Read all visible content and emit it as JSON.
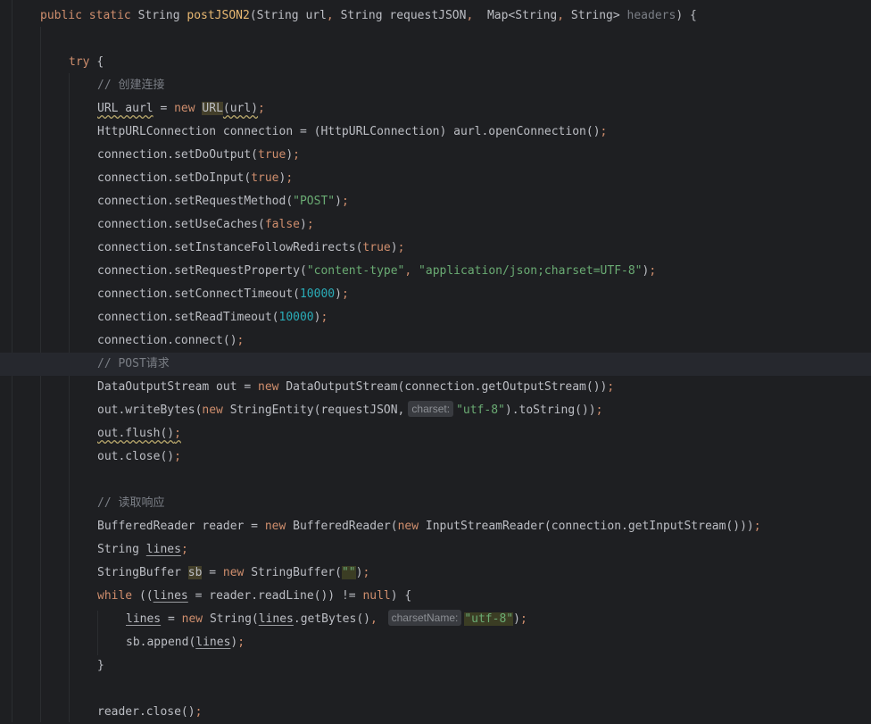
{
  "editor": {
    "lines": [
      {
        "id": "sig",
        "current": false,
        "tokens": [
          {
            "t": "public static ",
            "c": "kw"
          },
          {
            "t": "String ",
            "c": "punct"
          },
          {
            "t": "postJSON2",
            "c": "fnd"
          },
          {
            "t": "(String url",
            "c": "punct"
          },
          {
            "t": ", ",
            "c": "kw"
          },
          {
            "t": "String requestJSON",
            "c": "punct"
          },
          {
            "t": ",  ",
            "c": "kw"
          },
          {
            "t": "Map<String",
            "c": "punct"
          },
          {
            "t": ", ",
            "c": "kw"
          },
          {
            "t": "String> ",
            "c": "punct"
          },
          {
            "t": "headers",
            "c": "muted"
          },
          {
            "t": ") {",
            "c": "punct"
          }
        ]
      },
      {
        "id": "blank1",
        "tokens": []
      },
      {
        "id": "try",
        "tokens": [
          {
            "t": "try ",
            "c": "kw"
          },
          {
            "t": "{",
            "c": "punct"
          }
        ]
      },
      {
        "id": "c1",
        "tokens": [
          {
            "t": "// 创建连接",
            "c": "cmt"
          }
        ]
      },
      {
        "id": "l1",
        "tokens": [
          {
            "t": "URL aurl",
            "c": "wavy"
          },
          {
            "t": " = ",
            "c": "punct"
          },
          {
            "t": "new ",
            "c": "kw"
          },
          {
            "t": "URL",
            "c": "hl"
          },
          {
            "t": "(url)",
            "c": "wavy"
          },
          {
            "t": ";",
            "c": "kw"
          }
        ]
      },
      {
        "id": "l2",
        "tokens": [
          {
            "t": "HttpURLConnection connection = (HttpURLConnection) aurl.openConnection()",
            "c": "punct"
          },
          {
            "t": ";",
            "c": "kw"
          }
        ]
      },
      {
        "id": "l3",
        "tokens": [
          {
            "t": "connection.setDoOutput(",
            "c": "punct"
          },
          {
            "t": "true",
            "c": "kw"
          },
          {
            "t": ")",
            "c": "punct"
          },
          {
            "t": ";",
            "c": "kw"
          }
        ]
      },
      {
        "id": "l4",
        "tokens": [
          {
            "t": "connection.setDoInput(",
            "c": "punct"
          },
          {
            "t": "true",
            "c": "kw"
          },
          {
            "t": ")",
            "c": "punct"
          },
          {
            "t": ";",
            "c": "kw"
          }
        ]
      },
      {
        "id": "l5",
        "tokens": [
          {
            "t": "connection.setRequestMethod(",
            "c": "punct"
          },
          {
            "t": "\"POST\"",
            "c": "str"
          },
          {
            "t": ")",
            "c": "punct"
          },
          {
            "t": ";",
            "c": "kw"
          }
        ]
      },
      {
        "id": "l6",
        "tokens": [
          {
            "t": "connection.setUseCaches(",
            "c": "punct"
          },
          {
            "t": "false",
            "c": "kw"
          },
          {
            "t": ")",
            "c": "punct"
          },
          {
            "t": ";",
            "c": "kw"
          }
        ]
      },
      {
        "id": "l7",
        "tokens": [
          {
            "t": "connection.setInstanceFollowRedirects(",
            "c": "punct"
          },
          {
            "t": "true",
            "c": "kw"
          },
          {
            "t": ")",
            "c": "punct"
          },
          {
            "t": ";",
            "c": "kw"
          }
        ]
      },
      {
        "id": "l8",
        "tokens": [
          {
            "t": "connection.setRequestProperty(",
            "c": "punct"
          },
          {
            "t": "\"content-type\"",
            "c": "str"
          },
          {
            "t": ", ",
            "c": "kw"
          },
          {
            "t": "\"application/json;charset=UTF-8\"",
            "c": "str"
          },
          {
            "t": ")",
            "c": "punct"
          },
          {
            "t": ";",
            "c": "kw"
          }
        ]
      },
      {
        "id": "l9",
        "tokens": [
          {
            "t": "connection.setConnectTimeout(",
            "c": "punct"
          },
          {
            "t": "10000",
            "c": "num"
          },
          {
            "t": ")",
            "c": "punct"
          },
          {
            "t": ";",
            "c": "kw"
          }
        ]
      },
      {
        "id": "l10",
        "tokens": [
          {
            "t": "connection.setReadTimeout(",
            "c": "punct"
          },
          {
            "t": "10000",
            "c": "num"
          },
          {
            "t": ")",
            "c": "punct"
          },
          {
            "t": ";",
            "c": "kw"
          }
        ]
      },
      {
        "id": "l11",
        "tokens": [
          {
            "t": "connection.connect()",
            "c": "punct"
          },
          {
            "t": ";",
            "c": "kw"
          }
        ]
      },
      {
        "id": "c2",
        "current": true,
        "tokens": [
          {
            "t": "// POST请求",
            "c": "cmt"
          }
        ]
      },
      {
        "id": "l12",
        "tokens": [
          {
            "t": "DataOutputStream out = ",
            "c": "punct"
          },
          {
            "t": "new ",
            "c": "kw"
          },
          {
            "t": "DataOutputStream(connection.getOutputStream())",
            "c": "punct"
          },
          {
            "t": ";",
            "c": "kw"
          }
        ]
      },
      {
        "id": "l13",
        "tokens": [
          {
            "t": "out.writeBytes(",
            "c": "punct"
          },
          {
            "t": "new ",
            "c": "kw"
          },
          {
            "t": "StringEntity(requestJSON,",
            "c": "punct"
          },
          {
            "t": "charset:",
            "c": "hint"
          },
          {
            "t": "\"utf-8\"",
            "c": "str"
          },
          {
            "t": ").toString())",
            "c": "punct"
          },
          {
            "t": ";",
            "c": "kw"
          }
        ]
      },
      {
        "id": "l14",
        "tokens": [
          {
            "t": "out.flush()",
            "c": "wavy"
          },
          {
            "t": ";",
            "c": "kw wavy"
          }
        ]
      },
      {
        "id": "l15",
        "tokens": [
          {
            "t": "out.close()",
            "c": "punct"
          },
          {
            "t": ";",
            "c": "kw"
          }
        ]
      },
      {
        "id": "blank2",
        "tokens": []
      },
      {
        "id": "c3",
        "tokens": [
          {
            "t": "// 读取响应",
            "c": "cmt"
          }
        ]
      },
      {
        "id": "l16",
        "tokens": [
          {
            "t": "BufferedReader reader = ",
            "c": "punct"
          },
          {
            "t": "new ",
            "c": "kw"
          },
          {
            "t": "BufferedReader(",
            "c": "punct"
          },
          {
            "t": "new ",
            "c": "kw"
          },
          {
            "t": "InputStreamReader(connection.getInputStream()))",
            "c": "punct"
          },
          {
            "t": ";",
            "c": "kw"
          }
        ]
      },
      {
        "id": "l17",
        "tokens": [
          {
            "t": "String ",
            "c": "punct"
          },
          {
            "t": "lines",
            "c": "ul"
          },
          {
            "t": ";",
            "c": "kw"
          }
        ]
      },
      {
        "id": "l18",
        "tokens": [
          {
            "t": "StringBuffer ",
            "c": "punct"
          },
          {
            "t": "sb",
            "c": "hl"
          },
          {
            "t": " = ",
            "c": "punct"
          },
          {
            "t": "new ",
            "c": "kw"
          },
          {
            "t": "StringBuffer(",
            "c": "punct"
          },
          {
            "t": "\"\"",
            "c": "str hlstr"
          },
          {
            "t": ")",
            "c": "punct"
          },
          {
            "t": ";",
            "c": "kw"
          }
        ]
      },
      {
        "id": "l19",
        "tokens": [
          {
            "t": "while ",
            "c": "kw"
          },
          {
            "t": "((",
            "c": "punct"
          },
          {
            "t": "lines",
            "c": "ul"
          },
          {
            "t": " = reader.readLine()) != ",
            "c": "punct"
          },
          {
            "t": "null",
            "c": "kw"
          },
          {
            "t": ") {",
            "c": "punct"
          }
        ]
      },
      {
        "id": "l20",
        "tokens": [
          {
            "t": "lines",
            "c": "ul"
          },
          {
            "t": " = ",
            "c": "punct"
          },
          {
            "t": "new ",
            "c": "kw"
          },
          {
            "t": "String(",
            "c": "punct"
          },
          {
            "t": "lines",
            "c": "ul"
          },
          {
            "t": ".getBytes()",
            "c": "punct"
          },
          {
            "t": ", ",
            "c": "kw"
          },
          {
            "t": "charsetName:",
            "c": "hint"
          },
          {
            "t": "\"utf-8\"",
            "c": "str hlstr"
          },
          {
            "t": ")",
            "c": "punct"
          },
          {
            "t": ";",
            "c": "kw"
          }
        ]
      },
      {
        "id": "l21",
        "tokens": [
          {
            "t": "sb.append(",
            "c": "punct"
          },
          {
            "t": "lines",
            "c": "ul"
          },
          {
            "t": ")",
            "c": "punct"
          },
          {
            "t": ";",
            "c": "kw"
          }
        ]
      },
      {
        "id": "close1",
        "tokens": [
          {
            "t": "}",
            "c": "punct"
          }
        ]
      },
      {
        "id": "blank3",
        "tokens": []
      },
      {
        "id": "l22",
        "tokens": [
          {
            "t": "reader.close()",
            "c": "punct"
          },
          {
            "t": ";",
            "c": "kw"
          }
        ]
      }
    ]
  }
}
